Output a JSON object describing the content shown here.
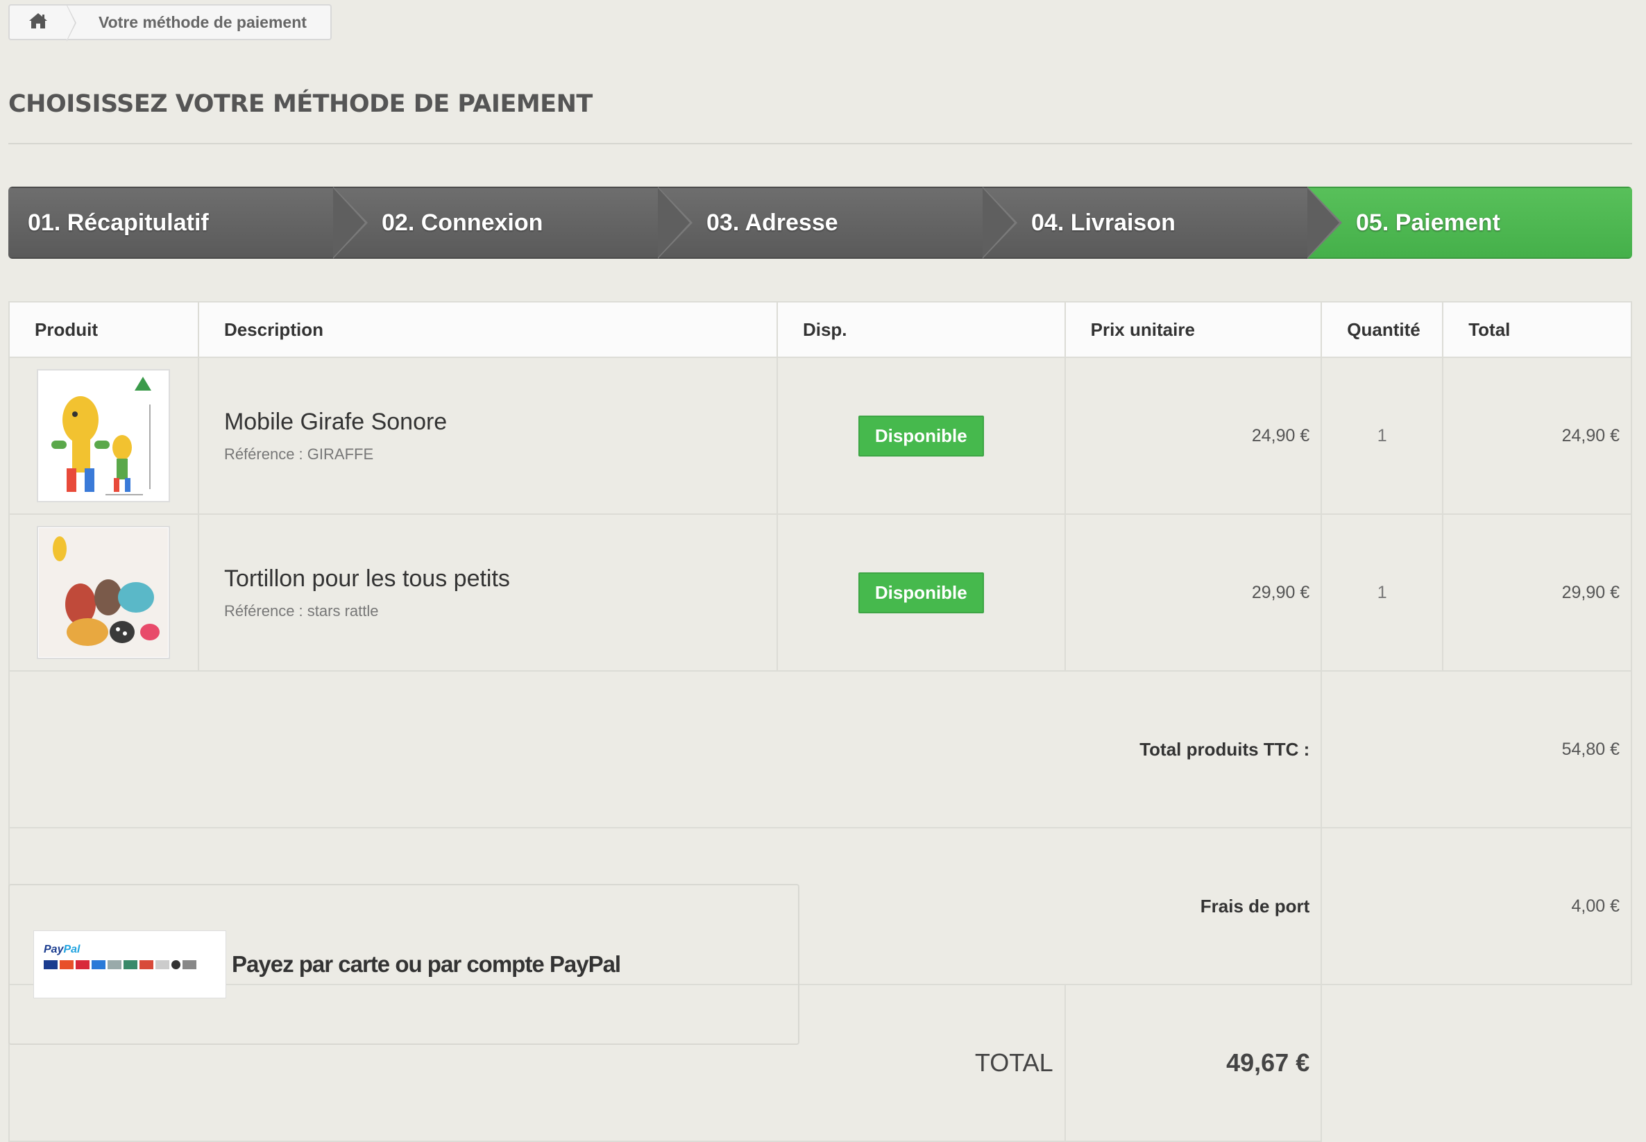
{
  "breadcrumb": {
    "home_icon": "home-icon",
    "current": "Votre méthode de paiement"
  },
  "page": {
    "title": "CHOISISSEZ VOTRE MÉTHODE DE PAIEMENT"
  },
  "steps": [
    {
      "label": "01. Récapitulatif",
      "active": false
    },
    {
      "label": "02. Connexion",
      "active": false
    },
    {
      "label": "03. Adresse",
      "active": false
    },
    {
      "label": "04. Livraison",
      "active": false
    },
    {
      "label": "05. Paiement",
      "active": true
    }
  ],
  "cart": {
    "headers": {
      "product": "Produit",
      "description": "Description",
      "availability": "Disp.",
      "unit_price": "Prix unitaire",
      "quantity": "Quantité",
      "total": "Total"
    },
    "items": [
      {
        "name": "Mobile Girafe Sonore",
        "reference": "Référence : GIRAFFE",
        "availability": "Disponible",
        "unit_price": "24,90 €",
        "quantity": "1",
        "total": "24,90 €"
      },
      {
        "name": "Tortillon pour les tous petits",
        "reference": "Référence : stars rattle",
        "availability": "Disponible",
        "unit_price": "29,90 €",
        "quantity": "1",
        "total": "29,90 €"
      }
    ],
    "summary": {
      "products_label": "Total produits TTC :",
      "products_value": "54,80 €",
      "shipping_label": "Frais de port",
      "shipping_value": "4,00 €",
      "total_label": "TOTAL",
      "total_value": "49,67 €"
    }
  },
  "payment": {
    "logo_brand_a": "Pay",
    "logo_brand_b": "Pal",
    "label": "Payez par carte ou par compte PayPal"
  },
  "colors": {
    "background": "#ecebe5",
    "step_inactive": "#626262",
    "step_active": "#4cb850",
    "badge": "#46b94d"
  }
}
